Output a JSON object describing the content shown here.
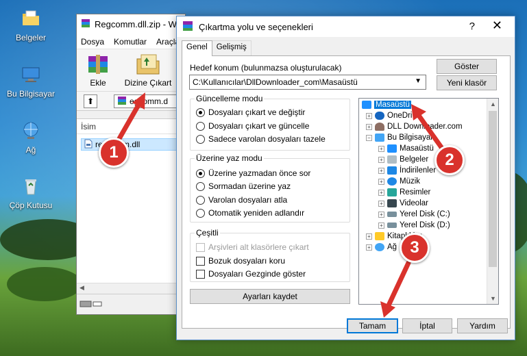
{
  "desktop": {
    "icons": [
      {
        "label": "Belgeler",
        "icon": "folder-icon"
      },
      {
        "label": "Bu Bilgisayar",
        "icon": "computer-icon"
      },
      {
        "label": "Ağ",
        "icon": "network-icon"
      },
      {
        "label": "Çöp Kutusu",
        "icon": "recycle-bin-icon"
      }
    ]
  },
  "winrar": {
    "title": "Regcomm.dll.zip - W",
    "menu": [
      "Dosya",
      "Komutlar",
      "Araçla"
    ],
    "toolbar": {
      "add": "Ekle",
      "extract_to": "Dizine Çıkart"
    },
    "path": "egcomm.d",
    "list_header": "İsim",
    "file": "regcomm.dll"
  },
  "dialog": {
    "title": "Çıkartma yolu ve seçenekleri",
    "help_glyph": "?",
    "close_glyph": "✕",
    "tabs": [
      "Genel",
      "Gelişmiş"
    ],
    "dest_label": "Hedef konum (bulunmazsa oluşturulacak)",
    "dest_value": "C:\\Kullanıcılar\\DllDownloader_com\\Masaüstü",
    "show_button": "Göster",
    "new_folder_button": "Yeni klasör",
    "update_group": {
      "title": "Güncelleme modu",
      "options": [
        "Dosyaları çıkart ve değiştir",
        "Dosyaları çıkart ve güncelle",
        "Sadece varolan dosyaları tazele"
      ],
      "selected": 0
    },
    "overwrite_group": {
      "title": "Üzerine yaz modu",
      "options": [
        "Üzerine yazmadan önce sor",
        "Sormadan üzerine yaz",
        "Varolan dosyaları atla",
        "Otomatik yeniden adlandır"
      ],
      "selected": 0
    },
    "misc_group": {
      "title": "Çeşitli",
      "options": [
        "Arşivleri alt klasörlere çıkart",
        "Bozuk dosyaları koru",
        "Dosyaları Gezginde göster"
      ]
    },
    "save_settings_button": "Ayarları kaydet",
    "tree": [
      {
        "label": "Masaüstü",
        "icon": "desktop-icon",
        "color": "#1e90ff"
      },
      {
        "label": "OneDri",
        "icon": "cloud-icon",
        "color": "#1565c0"
      },
      {
        "label": "DLL Downloader.com",
        "icon": "user-icon",
        "color": "#8d6e63"
      },
      {
        "label": "Bu Bilgisayar",
        "icon": "computer-icon",
        "color": "#42a5f5"
      },
      {
        "label": "Masaüstü",
        "icon": "desktop-icon",
        "color": "#1e90ff"
      },
      {
        "label": "Belgeler",
        "icon": "document-icon",
        "color": "#b0bec5"
      },
      {
        "label": "İndirilenler",
        "icon": "download-icon",
        "color": "#1e88e5"
      },
      {
        "label": "Müzik",
        "icon": "music-icon",
        "color": "#1e88e5"
      },
      {
        "label": "Resimler",
        "icon": "picture-icon",
        "color": "#26a69a"
      },
      {
        "label": "Videolar",
        "icon": "video-icon",
        "color": "#37474f"
      },
      {
        "label": "Yerel Disk (C:)",
        "icon": "drive-icon",
        "color": "#78909c"
      },
      {
        "label": "Yerel Disk (D:)",
        "icon": "drive-icon",
        "color": "#78909c"
      },
      {
        "label": "Kitaplıklar",
        "icon": "library-icon",
        "color": "#ffca28"
      },
      {
        "label": "Ağ",
        "icon": "network-icon",
        "color": "#42a5f5"
      }
    ],
    "ok_button": "Tamam",
    "cancel_button": "İptal",
    "help_button": "Yardım"
  },
  "annotations": {
    "step1": "1",
    "step2": "2",
    "step3": "3",
    "color": "#d9322c"
  }
}
